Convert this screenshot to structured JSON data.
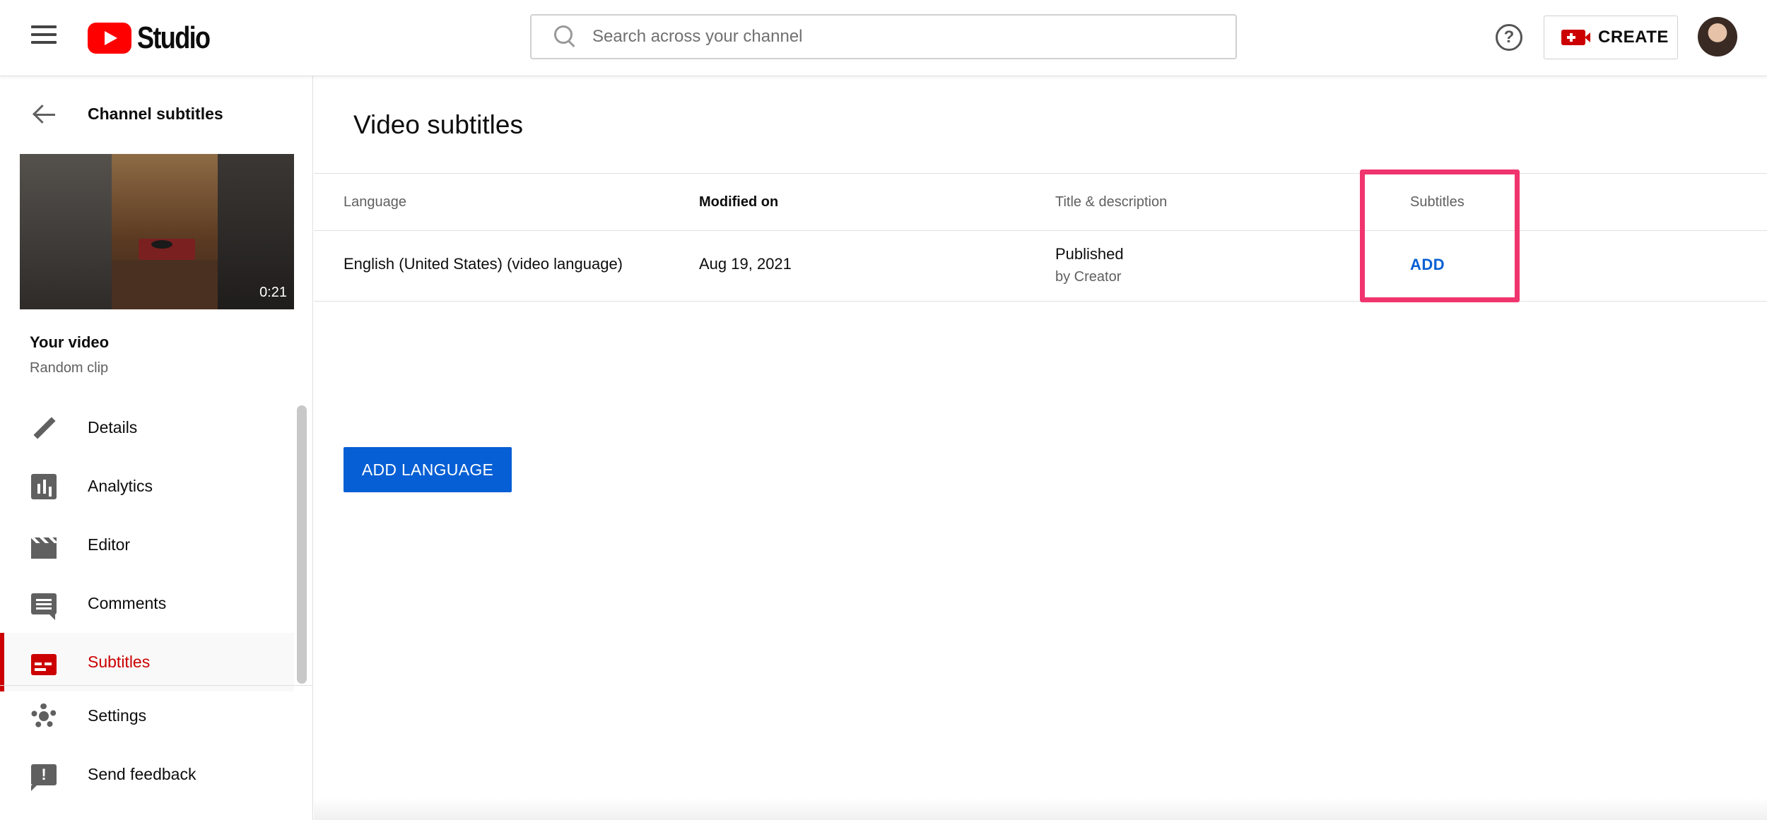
{
  "header": {
    "logo_text": "Studio",
    "search_placeholder": "Search across your channel",
    "create_label": "CREATE"
  },
  "sidebar": {
    "back_title": "Channel subtitles",
    "thumbnail_duration": "0:21",
    "your_video_label": "Your video",
    "video_name": "Random clip",
    "items": [
      {
        "label": "Details",
        "icon": "pencil-icon",
        "active": false
      },
      {
        "label": "Analytics",
        "icon": "analytics-icon",
        "active": false
      },
      {
        "label": "Editor",
        "icon": "clapperboard-icon",
        "active": false
      },
      {
        "label": "Comments",
        "icon": "comment-icon",
        "active": false
      },
      {
        "label": "Subtitles",
        "icon": "subtitles-icon",
        "active": true
      }
    ],
    "bottom_items": [
      {
        "label": "Settings",
        "icon": "gear-icon"
      },
      {
        "label": "Send feedback",
        "icon": "feedback-icon"
      }
    ]
  },
  "main": {
    "title": "Video subtitles",
    "columns": [
      "Language",
      "Modified on",
      "Title & description",
      "Subtitles"
    ],
    "rows": [
      {
        "language": "English (United States) (video language)",
        "modified_on": "Aug 19, 2021",
        "title_status": "Published",
        "title_by": "by Creator",
        "subtitles_action": "ADD"
      }
    ],
    "add_language_label": "ADD LANGUAGE"
  },
  "colors": {
    "accent_red": "#cc0000",
    "link_blue": "#065fd4",
    "highlight_pink": "#f0346e"
  }
}
